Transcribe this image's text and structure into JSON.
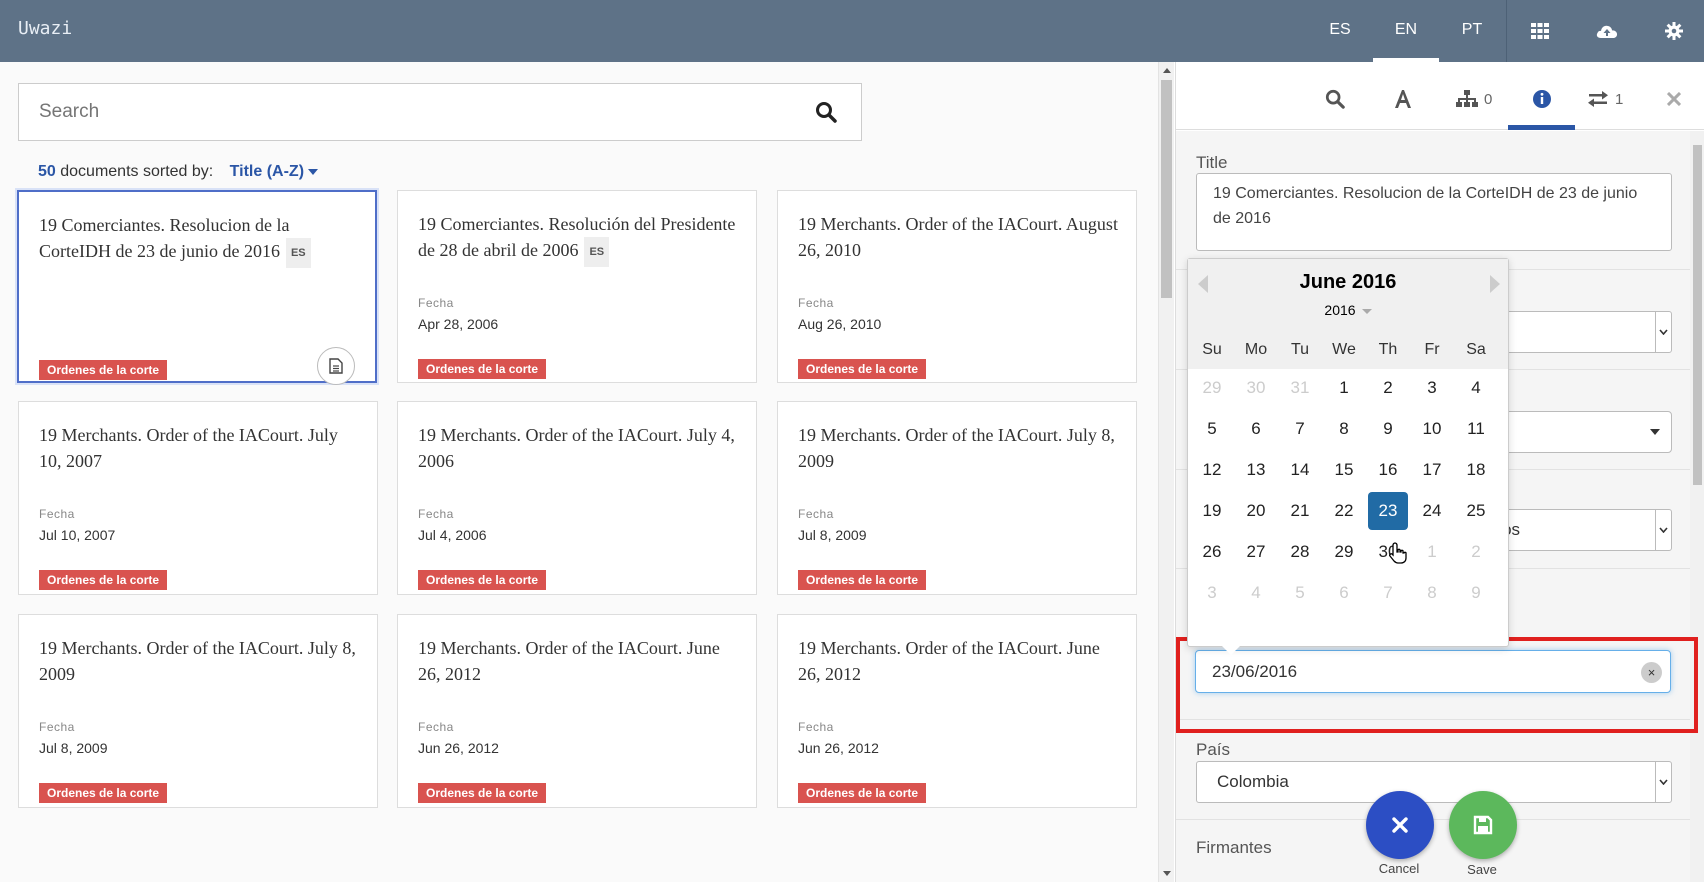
{
  "app": {
    "name": "Uwazi"
  },
  "languages": [
    {
      "code": "ES",
      "active": false
    },
    {
      "code": "EN",
      "active": true
    },
    {
      "code": "PT",
      "active": false
    }
  ],
  "toolbar_icons": [
    "grid-icon",
    "cloud-upload-icon",
    "gear-icon"
  ],
  "search": {
    "placeholder": "Search",
    "value": ""
  },
  "sort": {
    "count": "50",
    "text": "documents sorted by:",
    "by": "Title (A-Z)"
  },
  "documents": [
    {
      "title": "19 Comerciantes. Resolucion de la CorteIDH de 23 de junio de 2016",
      "lang": "ES",
      "date_label": "",
      "date": "",
      "template": "Ordenes de la corte",
      "selected": true
    },
    {
      "title": "19 Comerciantes. Resolución del Presidente de 28 de abril de 2006",
      "lang": "ES",
      "date_label": "Fecha",
      "date": "Apr 28, 2006",
      "template": "Ordenes de la corte"
    },
    {
      "title": "19 Merchants. Order of the IACourt. August 26, 2010",
      "lang": "",
      "date_label": "Fecha",
      "date": "Aug 26, 2010",
      "template": "Ordenes de la corte"
    },
    {
      "title": "19 Merchants. Order of the IACourt. July 10, 2007",
      "lang": "",
      "date_label": "Fecha",
      "date": "Jul 10, 2007",
      "template": "Ordenes de la corte"
    },
    {
      "title": "19 Merchants. Order of the IACourt. July 4, 2006",
      "lang": "",
      "date_label": "Fecha",
      "date": "Jul 4, 2006",
      "template": "Ordenes de la corte"
    },
    {
      "title": "19 Merchants. Order of the IACourt. July 8, 2009",
      "lang": "",
      "date_label": "Fecha",
      "date": "Jul 8, 2009",
      "template": "Ordenes de la corte"
    },
    {
      "title": "19 Merchants. Order of the IACourt. July 8, 2009",
      "lang": "",
      "date_label": "Fecha",
      "date": "Jul 8, 2009",
      "template": "Ordenes de la corte"
    },
    {
      "title": "19 Merchants. Order of the IACourt. June 26, 2012",
      "lang": "",
      "date_label": "Fecha",
      "date": "Jun 26, 2012",
      "template": "Ordenes de la corte"
    },
    {
      "title": "19 Merchants. Order of the IACourt. June 26, 2012",
      "lang": "",
      "date_label": "Fecha",
      "date": "Jun 26, 2012",
      "template": "Ordenes de la corte"
    }
  ],
  "panel": {
    "tabs": [
      {
        "icon": "search-icon",
        "label": ""
      },
      {
        "icon": "font-icon",
        "label": ""
      },
      {
        "icon": "sitemap-icon",
        "label": "0"
      },
      {
        "icon": "info-icon",
        "label": ""
      },
      {
        "icon": "exchange-icon",
        "label": "1"
      }
    ],
    "title_label": "Title",
    "title_value": "19 Comerciantes. Resolucion de la CorteIDH de 23 de junio de 2016",
    "partial_select_value": "manos",
    "date_value": "23/06/2016",
    "pais_label": "País",
    "pais_value": "Colombia",
    "firmantes_label": "Firmantes"
  },
  "datepicker": {
    "month_title": "June 2016",
    "year": "2016",
    "weekdays": [
      "Su",
      "Mo",
      "Tu",
      "We",
      "Th",
      "Fr",
      "Sa"
    ],
    "weeks": [
      [
        [
          "29",
          1
        ],
        [
          "30",
          1
        ],
        [
          "31",
          1
        ],
        [
          "1",
          0
        ],
        [
          "2",
          0
        ],
        [
          "3",
          0
        ],
        [
          "4",
          0
        ]
      ],
      [
        [
          "5",
          0
        ],
        [
          "6",
          0
        ],
        [
          "7",
          0
        ],
        [
          "8",
          0
        ],
        [
          "9",
          0
        ],
        [
          "10",
          0
        ],
        [
          "11",
          0
        ]
      ],
      [
        [
          "12",
          0
        ],
        [
          "13",
          0
        ],
        [
          "14",
          0
        ],
        [
          "15",
          0
        ],
        [
          "16",
          0
        ],
        [
          "17",
          0
        ],
        [
          "18",
          0
        ]
      ],
      [
        [
          "19",
          0
        ],
        [
          "20",
          0
        ],
        [
          "21",
          0
        ],
        [
          "22",
          0
        ],
        [
          "23",
          2
        ],
        [
          "24",
          0
        ],
        [
          "25",
          0
        ]
      ],
      [
        [
          "26",
          0
        ],
        [
          "27",
          0
        ],
        [
          "28",
          0
        ],
        [
          "29",
          0
        ],
        [
          "30",
          0
        ],
        [
          "1",
          1
        ],
        [
          "2",
          1
        ]
      ],
      [
        [
          "3",
          1
        ],
        [
          "4",
          1
        ],
        [
          "5",
          1
        ],
        [
          "6",
          1
        ],
        [
          "7",
          1
        ],
        [
          "8",
          1
        ],
        [
          "9",
          1
        ]
      ]
    ]
  },
  "actions": {
    "cancel": "Cancel",
    "save": "Save"
  },
  "colors": {
    "topbar": "#5e7287",
    "accent": "#2b56a6",
    "tag": "#d9534f",
    "cancel": "#2c4ec4",
    "save": "#5cb85c",
    "highlight": "#e0201e"
  }
}
